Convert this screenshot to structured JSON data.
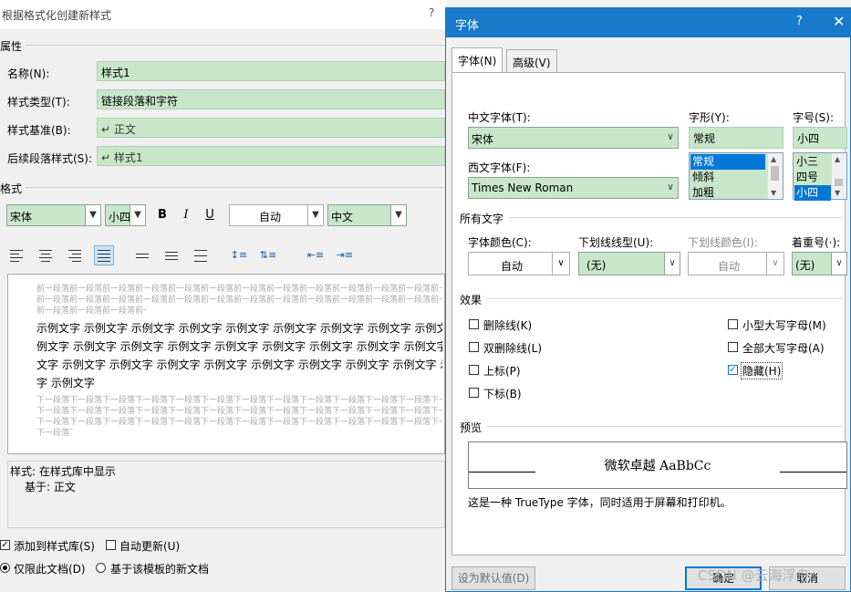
{
  "bg_dialog": {
    "title": "根据格式化创建新样式",
    "help": "?",
    "section_properties": "属性",
    "name_label": "名称(N):",
    "name_value": "样式1",
    "type_label": "样式类型(T):",
    "type_value": "链接段落和字符",
    "based_label": "样式基准(B):",
    "based_value": "↵ 正文",
    "next_label": "后续段落样式(S):",
    "next_value": "↵ 样式1",
    "section_format": "格式",
    "font_value": "宋体",
    "size_value": "小四",
    "bold": "B",
    "italic": "I",
    "underline": "U",
    "color_value": "自动",
    "lang_value": "中文",
    "prev_para_text": "前一段落前一段落前一段落前一段落前一段落前一段落前一段落前一段落前一段落前一段落前一段落前一段落前一段落前一段落前一段落前一段落前一段落前一段落前一段落前一段落",
    "sample_lines": [
      "示例文字 示例文字 示例文字 示例文字 示例文字 示例文字 示例文字 示例文字 示例文字 示",
      "例文字 示例文字 示例文字 示例文字 示例文字 示例文字 示例文字 示例文字 示例文字 示例",
      "文字 示例文字 示例文字 示例文字 示例文字 示例文字 示例文字 示例文字 示例文字 示例文",
      "字 示例文字"
    ],
    "next_para_text": "下一段落下一段落下一段落下一段落下一段落下一段落下一段落下一段落下一段落下一段落下一段落下一段落下一段落下一段落下一段落下一段落下一段落下一段落下一段落下一段落",
    "desc_line1": "样式: 在样式库中显示",
    "desc_line2": "基于: 正文",
    "add_to_gallery": "添加到样式库(S)",
    "auto_update": "自动更新(U)",
    "only_this_doc": "仅限此文档(D)",
    "new_docs_template": "基于该模板的新文档"
  },
  "font_dialog": {
    "title": "字体",
    "help": "?",
    "close": "✕",
    "tabs": [
      "字体(N)",
      "高级(V)"
    ],
    "cn_font_label": "中文字体(T):",
    "cn_font_value": "宋体",
    "western_font_label": "西文字体(F):",
    "western_font_value": "Times New Roman",
    "style_label": "字形(Y):",
    "style_value": "常规",
    "style_options": [
      "常规",
      "倾斜",
      "加粗"
    ],
    "size_label": "字号(S):",
    "size_value": "小四",
    "size_options": [
      "小三",
      "四号",
      "小四"
    ],
    "all_text_label": "所有文字",
    "font_color_label": "字体颜色(C):",
    "font_color_value": "自动",
    "underline_style_label": "下划线线型(U):",
    "underline_style_value": "(无)",
    "underline_color_label": "下划线颜色(I):",
    "underline_color_value": "自动",
    "emphasis_label": "着重号(·):",
    "emphasis_value": "(无)",
    "effects_label": "效果",
    "effects_left": [
      "删除线(K)",
      "双删除线(L)",
      "上标(P)",
      "下标(B)"
    ],
    "effects_right": [
      "小型大写字母(M)",
      "全部大写字母(A)",
      "隐藏(H)"
    ],
    "hidden_checked": true,
    "preview_label": "预览",
    "preview_text": "微软卓越  AaBbCc",
    "truetype_note": "这是一种 TrueType 字体，同时适用于屏幕和打印机。",
    "set_default": "设为默认值(D)",
    "ok": "确定",
    "cancel": "取消"
  },
  "watermark": "CSDN @云海浮舟",
  "colors": {
    "accent": "#1979ca",
    "field_green": "#c8e6c9",
    "selection": "#0078d7"
  }
}
